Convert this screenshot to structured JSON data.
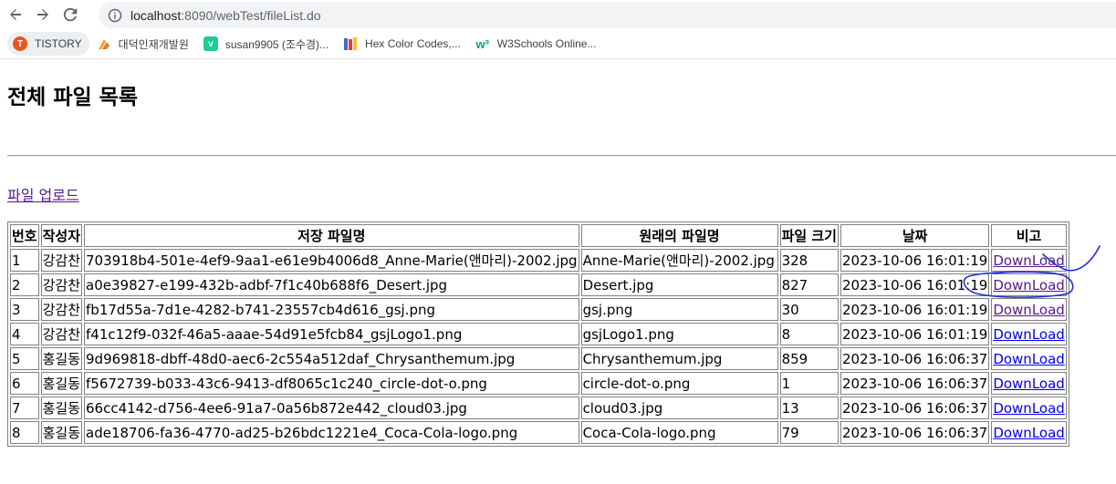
{
  "browser": {
    "url_host": "localhost",
    "url_rest": ":8090/webTest/fileList.do",
    "bookmarks": [
      {
        "label": "TISTORY",
        "icon": "tistory-icon",
        "color": "#eb531f"
      },
      {
        "label": "대덕인재개발원",
        "icon": "ddit-icon",
        "color": "#f2a13b"
      },
      {
        "label": "susan9905 (조수경)...",
        "icon": "velog-icon",
        "color": "#20c997"
      },
      {
        "label": "Hex Color Codes,...",
        "icon": "books-icon",
        "color": "#3d6cc4"
      },
      {
        "label": "W3Schools Online...",
        "icon": "w3schools-icon",
        "color": "#04aa6d"
      }
    ]
  },
  "page": {
    "title": "전체 파일 목록",
    "upload_link": "파일 업로드"
  },
  "table": {
    "headers": [
      "번호",
      "작성자",
      "저장 파일명",
      "원래의 파일명",
      "파일 크기",
      "날짜",
      "비고"
    ],
    "rows": [
      [
        "1",
        "강감찬",
        "703918b4-501e-4ef9-9aa1-e61e9b4006d8_Anne-Marie(앤마리)-2002.jpg",
        "Anne-Marie(앤마리)-2002.jpg",
        "328",
        "2023-10-06 16:01:19",
        "DownLoad"
      ],
      [
        "2",
        "강감찬",
        "a0e39827-e199-432b-adbf-7f1c40b688f6_Desert.jpg",
        "Desert.jpg",
        "827",
        "2023-10-06 16:01:19",
        "DownLoad"
      ],
      [
        "3",
        "강감찬",
        "fb17d55a-7d1e-4282-b741-23557cb4d616_gsj.png",
        "gsj.png",
        "30",
        "2023-10-06 16:01:19",
        "DownLoad"
      ],
      [
        "4",
        "강감찬",
        "f41c12f9-032f-46a5-aaae-54d91e5fcb84_gsjLogo1.png",
        "gsjLogo1.png",
        "8",
        "2023-10-06 16:01:19",
        "DownLoad"
      ],
      [
        "5",
        "홍길동",
        "9d969818-dbff-48d0-aec6-2c554a512daf_Chrysanthemum.jpg",
        "Chrysanthemum.jpg",
        "859",
        "2023-10-06 16:06:37",
        "DownLoad"
      ],
      [
        "6",
        "홍길동",
        "f5672739-b033-43c6-9413-df8065c1c240_circle-dot-o.png",
        "circle-dot-o.png",
        "1",
        "2023-10-06 16:06:37",
        "DownLoad"
      ],
      [
        "7",
        "홍길동",
        "66cc4142-d756-4ee6-91a7-0a56b872e442_cloud03.jpg",
        "cloud03.jpg",
        "13",
        "2023-10-06 16:06:37",
        "DownLoad"
      ],
      [
        "8",
        "홍길동",
        "ade18706-fa36-4770-ad25-b26bdc1221e4_Coca-Cola-logo.png",
        "Coca-Cola-logo.png",
        "79",
        "2023-10-06 16:06:37",
        "DownLoad"
      ]
    ]
  },
  "colors": {
    "link_visited": "#551a8b",
    "link": "#0000ee",
    "ink_annotation": "#1f2fd6"
  }
}
